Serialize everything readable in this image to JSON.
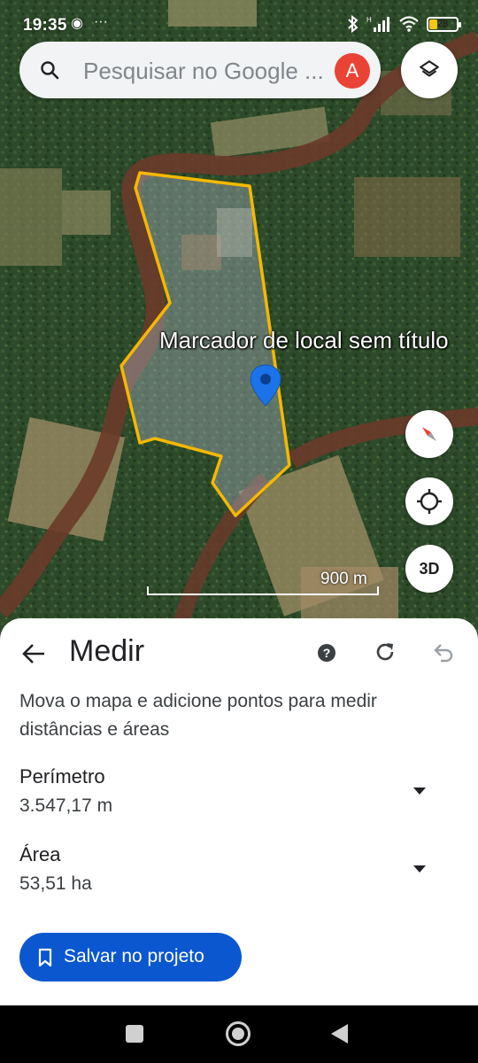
{
  "status_bar": {
    "time": "19:35",
    "left_icons": [
      "chrome-notification-icon",
      "more-dots-icon"
    ],
    "right_icons": [
      "bluetooth-icon",
      "signal-icon",
      "wifi-icon"
    ],
    "network_tag": "H",
    "battery_level": "28",
    "battery_fraction": 0.28
  },
  "search": {
    "placeholder": "Pesquisar no Google ...",
    "avatar_letter": "A"
  },
  "map": {
    "place_label": "Marcador de local sem título",
    "scale_label": "900 m",
    "three_d_label": "3D",
    "polygon_color": "#f5b800",
    "pin_color": "#1a73e8"
  },
  "measure": {
    "title": "Medir",
    "instructions": "Mova o mapa e adicione pontos para medir distâncias e áreas",
    "perimeter_label": "Perímetro",
    "perimeter_value": "3.547,17 m",
    "area_label": "Área",
    "area_value": "53,51 ha",
    "save_label": "Salvar no projeto",
    "accent_color": "#0b57d0"
  },
  "nav_bar": {
    "buttons": [
      "recents-button",
      "home-button",
      "back-nav-button"
    ]
  }
}
